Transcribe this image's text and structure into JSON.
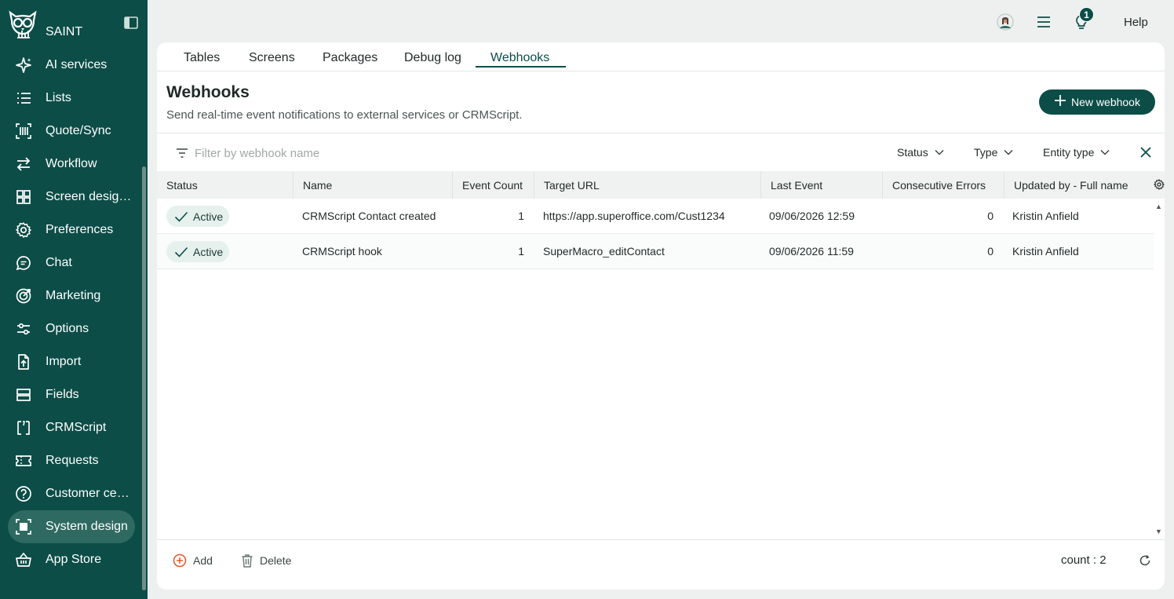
{
  "sidebar": {
    "items": [
      {
        "label": "SAINT",
        "icon": "saint-icon"
      },
      {
        "label": "AI services",
        "icon": "sparkle-icon"
      },
      {
        "label": "Lists",
        "icon": "list-icon"
      },
      {
        "label": "Quote/Sync",
        "icon": "barcode-icon"
      },
      {
        "label": "Workflow",
        "icon": "arrows-icon"
      },
      {
        "label": "Screen designer",
        "icon": "grid-icon"
      },
      {
        "label": "Preferences",
        "icon": "gear-icon"
      },
      {
        "label": "Chat",
        "icon": "chat-icon"
      },
      {
        "label": "Marketing",
        "icon": "target-icon"
      },
      {
        "label": "Options",
        "icon": "sliders-icon"
      },
      {
        "label": "Import",
        "icon": "import-icon"
      },
      {
        "label": "Fields",
        "icon": "fields-icon"
      },
      {
        "label": "CRMScript",
        "icon": "script-icon"
      },
      {
        "label": "Requests",
        "icon": "ticket-icon"
      },
      {
        "label": "Customer center",
        "icon": "help-circle-icon"
      },
      {
        "label": "System design",
        "icon": "system-design-icon",
        "active": true
      },
      {
        "label": "App Store",
        "icon": "basket-icon"
      }
    ]
  },
  "topbar": {
    "notifications_count": "1",
    "help_label": "Help"
  },
  "tabs": [
    {
      "label": "Tables"
    },
    {
      "label": "Screens"
    },
    {
      "label": "Packages"
    },
    {
      "label": "Debug log"
    },
    {
      "label": "Webhooks",
      "active": true
    }
  ],
  "header": {
    "title": "Webhooks",
    "subtitle": "Send real-time event notifications to external services or CRMScript.",
    "new_button_label": "New webhook"
  },
  "filter": {
    "placeholder": "Filter by webhook name",
    "value": "",
    "dropdowns": [
      "Status",
      "Type",
      "Entity type"
    ]
  },
  "table": {
    "columns": [
      "Status",
      "Name",
      "Event Count",
      "Target URL",
      "Last Event",
      "Consecutive Errors",
      "Updated by - Full name"
    ],
    "rows": [
      {
        "status": "Active",
        "name": "CRMScript Contact created",
        "event_count": "1",
        "target_url": "https://app.superoffice.com/Cust1234",
        "last_event": "09/06/2026 12:59",
        "consecutive_errors": "0",
        "updated_by": "Kristin Anfield"
      },
      {
        "status": "Active",
        "name": "CRMScript hook",
        "event_count": "1",
        "target_url": "SuperMacro_editContact",
        "last_event": "09/06/2026 11:59",
        "consecutive_errors": "0",
        "updated_by": "Kristin Anfield"
      }
    ]
  },
  "footer": {
    "add_label": "Add",
    "delete_label": "Delete",
    "count_text": "count : 2"
  },
  "colors": {
    "brand": "#0c4d47",
    "active_nav": "#2e6a62",
    "add_accent": "#e0592a"
  }
}
